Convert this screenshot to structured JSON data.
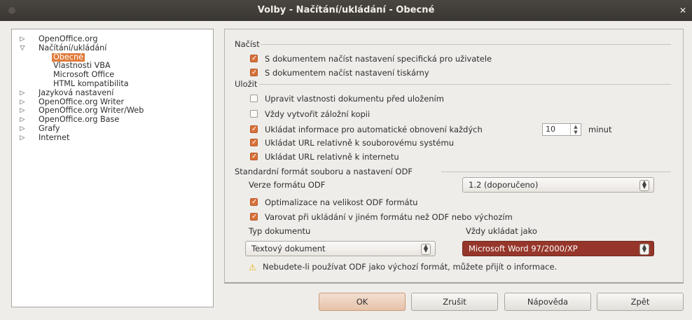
{
  "window": {
    "title": "Volby - Načítání/ukládání - Obecné"
  },
  "tree": [
    {
      "label": "OpenOffice.org",
      "arrow": "▷",
      "level": 0
    },
    {
      "label": "Načítání/ukládání",
      "arrow": "▽",
      "level": 0
    },
    {
      "label": "Obecné",
      "arrow": "",
      "level": 1,
      "selected": true
    },
    {
      "label": "Vlastnosti VBA",
      "arrow": "",
      "level": 1
    },
    {
      "label": "Microsoft Office",
      "arrow": "",
      "level": 1
    },
    {
      "label": "HTML kompatibilita",
      "arrow": "",
      "level": 1
    },
    {
      "label": "Jazyková nastavení",
      "arrow": "▷",
      "level": 0
    },
    {
      "label": "OpenOffice.org Writer",
      "arrow": "▷",
      "level": 0
    },
    {
      "label": "OpenOffice.org Writer/Web",
      "arrow": "▷",
      "level": 0
    },
    {
      "label": "OpenOffice.org Base",
      "arrow": "▷",
      "level": 0
    },
    {
      "label": "Grafy",
      "arrow": "▷",
      "level": 0
    },
    {
      "label": "Internet",
      "arrow": "▷",
      "level": 0
    }
  ],
  "load": {
    "heading": "Načíst",
    "opt1": "S dokumentem načíst nastavení specifická pro uživatele",
    "opt2": "S dokumentem načíst nastavení tiskárny"
  },
  "save": {
    "heading": "Uložit",
    "opt1": "Upravit vlastnosti dokumentu před uložením",
    "opt2": "Vždy vytvořit záložní kopii",
    "opt3": "Ukládat informace pro automatické obnovení každých",
    "autosave_value": "10",
    "autosave_unit": "minut",
    "opt4": "Ukládat URL relativně k souborovému systému",
    "opt5": "Ukládat URL relativně k internetu"
  },
  "odf": {
    "heading": "Standardní formát souboru a nastavení ODF",
    "version_label": "Verze formátu ODF",
    "version_value": "1.2 (doporučeno)",
    "opt1": "Optimalizace na velikost ODF formátu",
    "opt2": "Varovat při ukládání v jiném formátu než ODF nebo výchozím",
    "doc_type_label": "Typ dokumentu",
    "doc_type_value": "Textový dokument",
    "always_save_label": "Vždy ukládat jako",
    "always_save_value": "Microsoft Word 97/2000/XP",
    "warning": "Nebudete-li používat ODF jako výchozí formát, můžete přijít o informace."
  },
  "buttons": {
    "ok": "OK",
    "cancel": "Zrušit",
    "help": "Nápověda",
    "back": "Zpět"
  },
  "colors": {
    "accent": "#d9703a",
    "selection": "#96362a",
    "titlebar": "#3f3a35"
  }
}
